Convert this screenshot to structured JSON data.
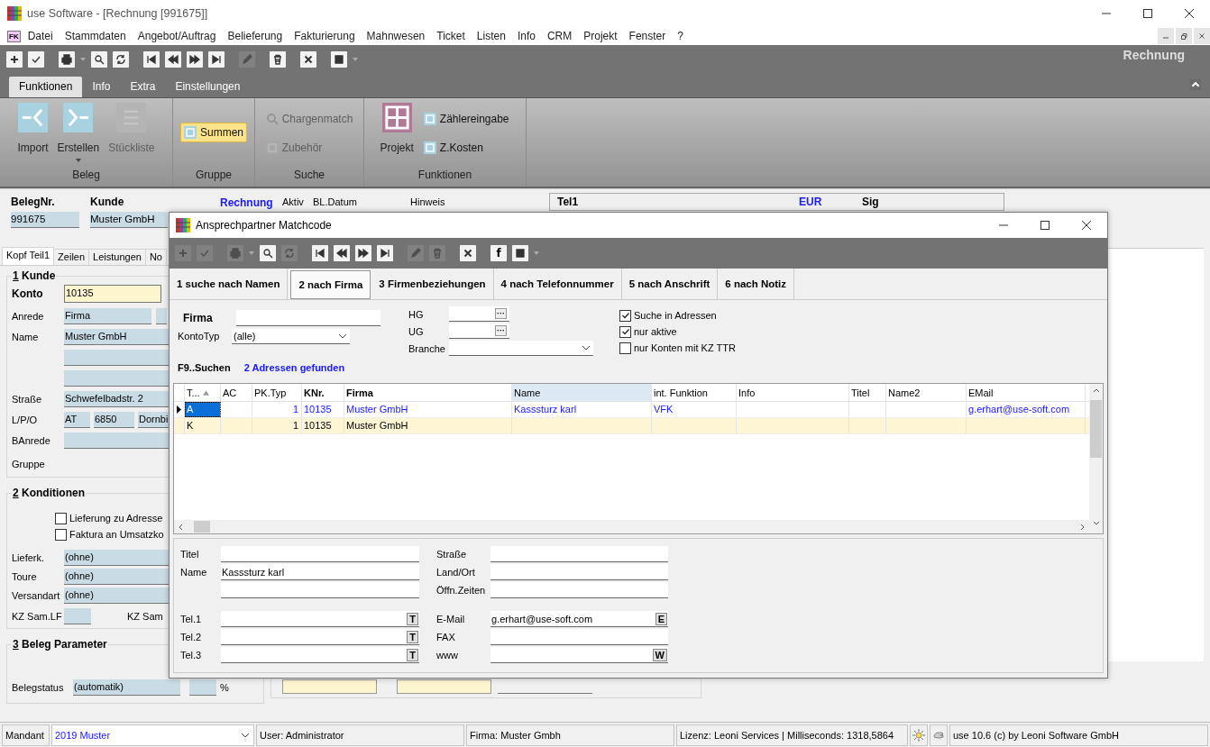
{
  "window": {
    "title": "use Software - [Rechnung [991675]]"
  },
  "menu_icon": "FK",
  "menu": [
    "Datei",
    "Stammdaten",
    "Angebot/Auftrag",
    "Belieferung",
    "Fakturierung",
    "Mahnwesen",
    "Ticket",
    "Listen",
    "Info",
    "CRM",
    "Projekt",
    "Fenster",
    "?"
  ],
  "toolbar": [
    {
      "disabled": false
    },
    {
      "disabled": false
    },
    {
      "disabled": false
    },
    {
      "disabled": false
    },
    {
      "disabled": false
    },
    {
      "disabled": false
    },
    {
      "disabled": false
    },
    {
      "disabled": false
    },
    {
      "disabled": false
    },
    {
      "disabled": true
    },
    {
      "disabled": false
    },
    {
      "disabled": false
    },
    {
      "disabled": false
    }
  ],
  "toolbar_title": "Rechnung",
  "ribbon_tabs": [
    {
      "label": "Funktionen",
      "selected": true
    },
    {
      "label": "Info",
      "selected": false
    },
    {
      "label": "Extra",
      "selected": false
    },
    {
      "label": "Einstellungen",
      "selected": false
    }
  ],
  "ribbon_groups": [
    {
      "label": "Beleg",
      "items": [
        {
          "kind": "large",
          "label": "Import",
          "disabled": false
        },
        {
          "kind": "large",
          "label": "Erstellen",
          "disabled": false,
          "dropdown": true
        },
        {
          "kind": "large",
          "label": "Stückliste",
          "disabled": true
        }
      ]
    },
    {
      "label": "Gruppe",
      "items": [
        {
          "kind": "highlight",
          "label": "Summen",
          "disabled": false
        }
      ]
    },
    {
      "label": "Suche",
      "items": [
        {
          "kind": "small",
          "label": "Chargenmatch",
          "disabled": true
        },
        {
          "kind": "small",
          "label": "Zubehör",
          "disabled": true
        }
      ]
    },
    {
      "label": "Funktionen",
      "items": [
        {
          "kind": "large",
          "label": "Projekt",
          "disabled": false
        },
        {
          "kind": "small",
          "label": "Zählereingabe",
          "disabled": false
        },
        {
          "kind": "small",
          "label": "Z.Kosten",
          "disabled": false
        }
      ]
    }
  ],
  "header": {
    "belegnr_label": "BelegNr.",
    "belegnr": "991675",
    "kunde_label": "Kunde",
    "kunde": "Muster GmbH",
    "doc_type": "Rechnung",
    "aktiv": "Aktiv",
    "bl_datum": "BL.Datum",
    "hinweis": "Hinweis"
  },
  "info_box": {
    "tel": "Tel1",
    "currency": "EUR",
    "sig": "Sig"
  },
  "form_tabs": [
    {
      "label": "Kopf Teil1",
      "selected": true
    },
    {
      "label": "Zeilen",
      "selected": false
    },
    {
      "label": "Leistungen",
      "selected": false
    },
    {
      "label": "No",
      "selected": false
    }
  ],
  "kunde": {
    "number": "1",
    "title": "Kunde",
    "konto_label": "Konto",
    "konto": "10135",
    "anrede_label": "Anrede",
    "anrede": "Firma",
    "name_label": "Name",
    "name": "Muster GmbH",
    "strasse_label": "Straße",
    "strasse": "Schwefelbadstr. 2",
    "lpo_label": "L/P/O",
    "land": "AT",
    "plz": "6850",
    "ort": "Dornbi",
    "banrede_label": "BAnrede",
    "gruppe_label": "Gruppe"
  },
  "konditionen": {
    "number": "2",
    "title": "Konditionen",
    "checkboxes": [
      {
        "label": "Lieferung zu Adresse",
        "checked": false
      },
      {
        "label": "Faktura an Umsatzko",
        "checked": false
      }
    ],
    "fields": [
      {
        "label": "Lieferk.",
        "value": "(ohne)"
      },
      {
        "label": "Toure",
        "value": "(ohne)"
      },
      {
        "label": "Versandart",
        "value": "(ohne)"
      }
    ],
    "kz_lf": "KZ Sam.LF",
    "kz2": "KZ Sam"
  },
  "beleg_parameter": {
    "number": "3",
    "title": "Beleg Parameter",
    "status_label": "Belegstatus",
    "status": "(automatik)",
    "percent": "%"
  },
  "dialog": {
    "title": "Ansprechpartner Matchcode",
    "toolbar": [
      {
        "disabled": true
      },
      {
        "disabled": true
      },
      {
        "disabled": true
      },
      {
        "disabled": false
      },
      {
        "disabled": true
      },
      {
        "disabled": false
      },
      {
        "disabled": false
      },
      {
        "disabled": false
      },
      {
        "disabled": false
      },
      {
        "disabled": true
      },
      {
        "disabled": true
      },
      {
        "disabled": false
      },
      {
        "disabled": false,
        "label": "f"
      },
      {
        "disabled": false
      }
    ],
    "tabs": [
      {
        "label": "1 suche nach Namen",
        "selected": false
      },
      {
        "label": "2 nach Firma",
        "selected": true
      },
      {
        "label": "3 Firmenbeziehungen",
        "selected": false
      },
      {
        "label": "4 nach Telefonnummer",
        "selected": false
      },
      {
        "label": "5 nach Anschrift",
        "selected": false
      },
      {
        "label": "6 nach Notiz",
        "selected": false
      }
    ],
    "firma_label": "Firma",
    "kontotyp_label": "KontoTyp",
    "kontotyp": "(alle)",
    "hg_label": "HG",
    "ug_label": "UG",
    "branche_label": "Branche",
    "more": "···",
    "options": [
      {
        "label": "Suche in Adressen",
        "checked": true
      },
      {
        "label": "nur aktive",
        "checked": true
      },
      {
        "label": "nur Konten mit KZ TTR",
        "checked": false
      }
    ],
    "search_hint": "F9..Suchen",
    "result": "2 Adressen gefunden",
    "columns": [
      {
        "label": "T...",
        "bold": false,
        "sorted": true,
        "highlighted": false
      },
      {
        "label": "AC",
        "bold": false,
        "sorted": false,
        "highlighted": false
      },
      {
        "label": "PK.Typ",
        "bold": false,
        "sorted": false,
        "highlighted": false
      },
      {
        "label": "KNr.",
        "bold": true,
        "sorted": false,
        "highlighted": false
      },
      {
        "label": "Firma",
        "bold": true,
        "sorted": false,
        "highlighted": false
      },
      {
        "label": "Name",
        "bold": false,
        "sorted": false,
        "highlighted": true
      },
      {
        "label": "int. Funktion",
        "bold": false,
        "sorted": false,
        "highlighted": false
      },
      {
        "label": "Info",
        "bold": false,
        "sorted": false,
        "highlighted": false
      },
      {
        "label": "Titel",
        "bold": false,
        "sorted": false,
        "highlighted": false
      },
      {
        "label": "Name2",
        "bold": false,
        "sorted": false,
        "highlighted": false
      },
      {
        "label": "EMail",
        "bold": false,
        "sorted": false,
        "highlighted": false
      }
    ],
    "rows": [
      {
        "kind": "contact",
        "selected": true,
        "cells": [
          "A",
          null,
          "1",
          "10135",
          "Muster GmbH",
          "Kasssturz karl",
          "VFK",
          null,
          null,
          null,
          "g.erhart@use-soft.com"
        ]
      },
      {
        "kind": "account",
        "selected": false,
        "cells": [
          "K",
          null,
          "1",
          "10135",
          "Muster GmbH",
          null,
          null,
          null,
          null,
          null,
          null
        ]
      }
    ],
    "detail_left": [
      {
        "label": "Titel"
      },
      {
        "label": "Name",
        "value": "Kasssturz karl",
        "extra_line": true
      },
      {
        "label": "Tel.1",
        "key": "T"
      },
      {
        "label": "Tel.2",
        "key": "T"
      },
      {
        "label": "Tel.3",
        "key": "T"
      }
    ],
    "detail_right": [
      {
        "label": "Straße"
      },
      {
        "label": "Land/Ort"
      },
      {
        "label": "Öffn.Zeiten"
      },
      {
        "label": "E-Mail",
        "value": "g.erhart@use-soft.com",
        "key": "E"
      },
      {
        "label": "FAX"
      },
      {
        "label": "www",
        "key": "W"
      }
    ]
  },
  "status_bar": {
    "mandant_label": "Mandant",
    "mandant": "2019 Muster",
    "user": "User: Administrator",
    "firma": "Firma: Muster Gmbh",
    "lizenz": "Lizenz: Leoni Services | Milliseconds: 1318,5864",
    "version": "use 10.6 (c) by Leoni Software GmbH"
  }
}
